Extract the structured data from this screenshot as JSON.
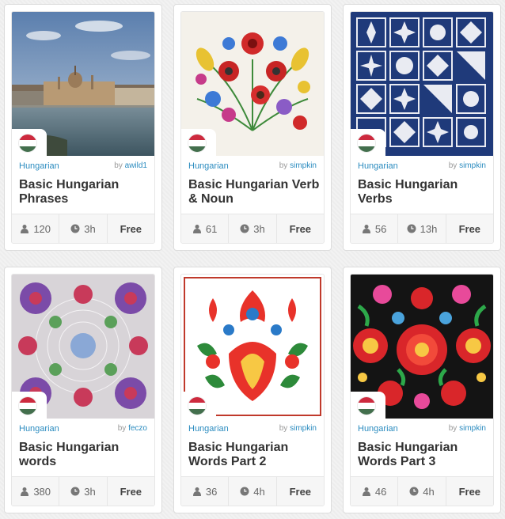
{
  "flag_colors": [
    "#cd2a3e",
    "#ffffff",
    "#436f4d"
  ],
  "courses": [
    {
      "language": "Hungarian",
      "by_prefix": "by",
      "author": "awild1",
      "title": "Basic Hungarian Phrases",
      "learners": "120",
      "time": "3h",
      "price": "Free",
      "image": "budapest-parliament"
    },
    {
      "language": "Hungarian",
      "by_prefix": "by",
      "author": "simpkin",
      "title": "Basic Hungarian Verb & Noun",
      "learners": "61",
      "time": "3h",
      "price": "Free",
      "image": "embroidery-flowers"
    },
    {
      "language": "Hungarian",
      "by_prefix": "by",
      "author": "simpkin",
      "title": "Basic Hungarian Verbs",
      "learners": "56",
      "time": "13h",
      "price": "Free",
      "image": "blue-quilt"
    },
    {
      "language": "Hungarian",
      "by_prefix": "by",
      "author": "feczo",
      "title": "Basic Hungarian words",
      "learners": "380",
      "time": "3h",
      "price": "Free",
      "image": "lace-embroidery"
    },
    {
      "language": "Hungarian",
      "by_prefix": "by",
      "author": "simpkin",
      "title": "Basic Hungarian Words Part 2",
      "learners": "36",
      "time": "4h",
      "price": "Free",
      "image": "red-folk-pattern"
    },
    {
      "language": "Hungarian",
      "by_prefix": "by",
      "author": "simpkin",
      "title": "Basic Hungarian Words Part 3",
      "learners": "46",
      "time": "4h",
      "price": "Free",
      "image": "matyo-embroidery"
    }
  ]
}
